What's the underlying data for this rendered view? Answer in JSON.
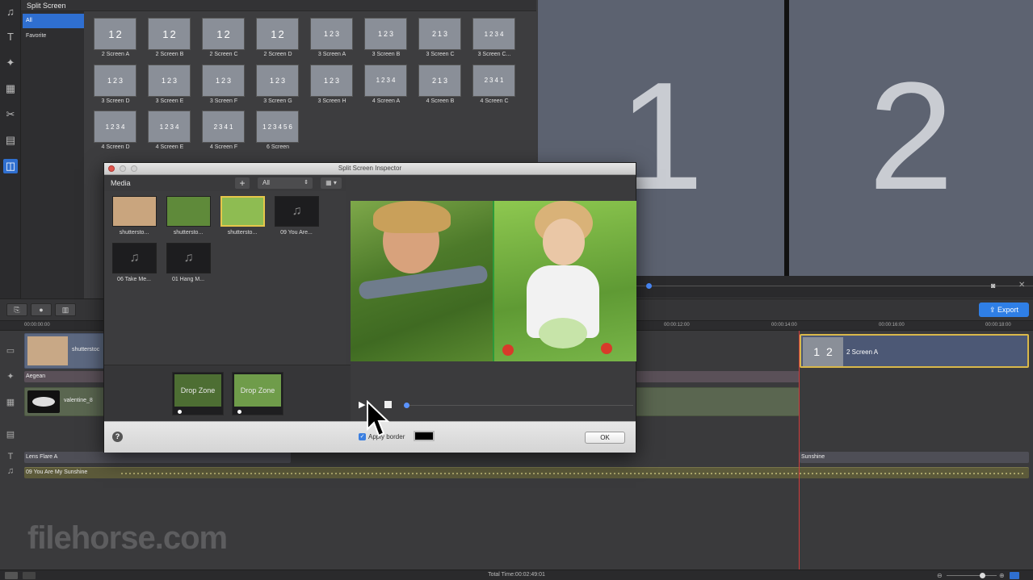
{
  "split_screen_panel": {
    "title": "Split Screen",
    "categories": [
      "All",
      "Favorite"
    ],
    "templates": [
      {
        "name": "2 Screen A",
        "cells": [
          "1",
          "2"
        ]
      },
      {
        "name": "2 Screen B",
        "cells": [
          "1",
          "2"
        ]
      },
      {
        "name": "2 Screen C",
        "cells": [
          "1",
          "2"
        ]
      },
      {
        "name": "2 Screen D",
        "cells": [
          "1",
          "2"
        ]
      },
      {
        "name": "3 Screen A",
        "cells": [
          "1",
          "2",
          "3"
        ]
      },
      {
        "name": "3 Screen B",
        "cells": [
          "1",
          "2",
          "3"
        ]
      },
      {
        "name": "3 Screen C",
        "cells": [
          "2",
          "1",
          "3"
        ]
      },
      {
        "name": "3 Screen C...",
        "cells": [
          "1",
          "2",
          "3",
          "4"
        ]
      },
      {
        "name": "3 Screen D",
        "cells": [
          "1",
          "2",
          "3"
        ]
      },
      {
        "name": "3 Screen E",
        "cells": [
          "1",
          "2",
          "3"
        ]
      },
      {
        "name": "3 Screen F",
        "cells": [
          "1",
          "2",
          "3"
        ]
      },
      {
        "name": "3 Screen G",
        "cells": [
          "1",
          "2",
          "3"
        ]
      },
      {
        "name": "3 Screen H",
        "cells": [
          "1",
          "2",
          "3"
        ]
      },
      {
        "name": "4 Screen A",
        "cells": [
          "1",
          "2",
          "3",
          "4"
        ]
      },
      {
        "name": "4 Screen B",
        "cells": [
          "2",
          "1",
          "3"
        ]
      },
      {
        "name": "4 Screen C",
        "cells": [
          "2",
          "3",
          "4",
          "1"
        ]
      },
      {
        "name": "4 Screen D",
        "cells": [
          "1",
          "2",
          "3",
          "4"
        ]
      },
      {
        "name": "4 Screen E",
        "cells": [
          "1",
          "2",
          "3",
          "4"
        ]
      },
      {
        "name": "4 Screen F",
        "cells": [
          "2",
          "3",
          "4",
          "1"
        ]
      },
      {
        "name": "6 Screen",
        "cells": [
          "1",
          "2",
          "3",
          "4",
          "5",
          "6"
        ]
      }
    ]
  },
  "preview": {
    "left": "1",
    "right": "2"
  },
  "timeline": {
    "export_label": "Export",
    "ruler": [
      "00:00:00:00",
      "00:00:12:00",
      "00:00:14:00",
      "00:00:16:00",
      "00:00:18:00"
    ],
    "clips": {
      "video": "shutterstoc",
      "split_screen": "2 Screen A",
      "ss_cells": [
        "1",
        "2"
      ],
      "aegean": "Aegean",
      "valentine": "valentine_8",
      "lens_flare": "Lens Flare A",
      "sunshine": "Sunshine",
      "audio": "09 You Are My Sunshine"
    },
    "total_time": "Total Time:00:02:49:01"
  },
  "dialog": {
    "title": "Split Screen Inspector",
    "media_label": "Media",
    "add_label": "+",
    "filter_value": "All",
    "view_label": "▦ ▾",
    "media_items": [
      {
        "label": "shuttersto...",
        "kind": "video",
        "color": "#c9a57e"
      },
      {
        "label": "shuttersto...",
        "kind": "video",
        "color": "#5f8a3a"
      },
      {
        "label": "shutterstо...",
        "kind": "video",
        "color": "#8ebc52"
      },
      {
        "label": "09 You Are...",
        "kind": "music"
      },
      {
        "label": "06 Take Me...",
        "kind": "music"
      },
      {
        "label": "01 Hang M...",
        "kind": "music"
      }
    ],
    "drop_zones": [
      "Drop Zone",
      "Drop Zone"
    ],
    "apply_border_label": "Apply border",
    "ok_label": "OK",
    "help_label": "?"
  },
  "watermark": "filehorse.com"
}
